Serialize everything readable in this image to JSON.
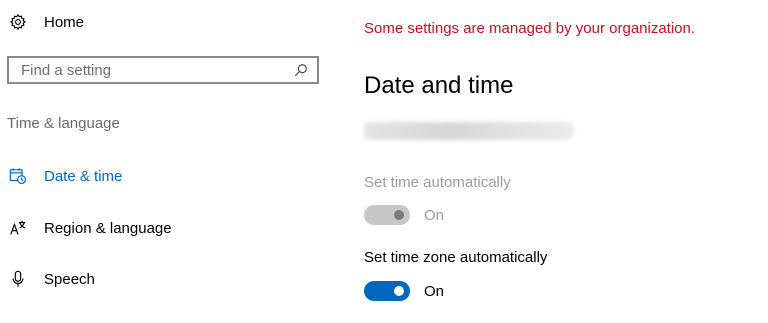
{
  "sidebar": {
    "home_label": "Home",
    "search": {
      "placeholder": "Find a setting",
      "value": ""
    },
    "section_label": "Time & language",
    "items": [
      {
        "label": "Date & time",
        "icon": "calendar-clock-icon",
        "active": true
      },
      {
        "label": "Region & language",
        "icon": "language-icon",
        "active": false
      },
      {
        "label": "Speech",
        "icon": "microphone-icon",
        "active": false
      }
    ]
  },
  "main": {
    "org_notice": "Some settings are managed by your organization.",
    "title": "Date and time",
    "settings": [
      {
        "label": "Set time automatically",
        "state_label": "On",
        "enabled": false
      },
      {
        "label": "Set time zone automatically",
        "state_label": "On",
        "enabled": true
      }
    ]
  },
  "colors": {
    "accent": "#0067c0",
    "warning": "#c50f1f",
    "disabled_text": "#9b9b9b"
  }
}
